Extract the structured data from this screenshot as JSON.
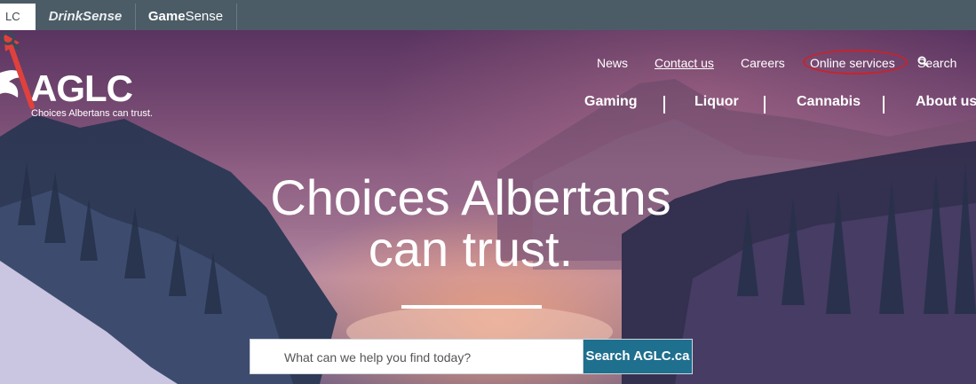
{
  "tabs": [
    {
      "label": "LC"
    },
    {
      "label": "DrinkSense"
    },
    {
      "label_pre": "Game",
      "label_post": "Sense"
    }
  ],
  "logo": {
    "name": "AGLC",
    "tagline": "Choices Albertans can trust."
  },
  "utility_nav": {
    "news": "News",
    "contact": "Contact us",
    "careers": "Careers",
    "online_services": "Online services",
    "search": "Search"
  },
  "main_nav": {
    "gaming": "Gaming",
    "liquor": "Liquor",
    "cannabis": "Cannabis",
    "about": "About us"
  },
  "hero": {
    "headline_line1": "Choices Albertans",
    "headline_line2": "can trust."
  },
  "search": {
    "placeholder": "What can we help you find today?",
    "button": "Search AGLC.ca"
  },
  "colors": {
    "tabbar": "#4c5c66",
    "annotation": "#c8232c",
    "search_button": "#1f6f8e"
  }
}
